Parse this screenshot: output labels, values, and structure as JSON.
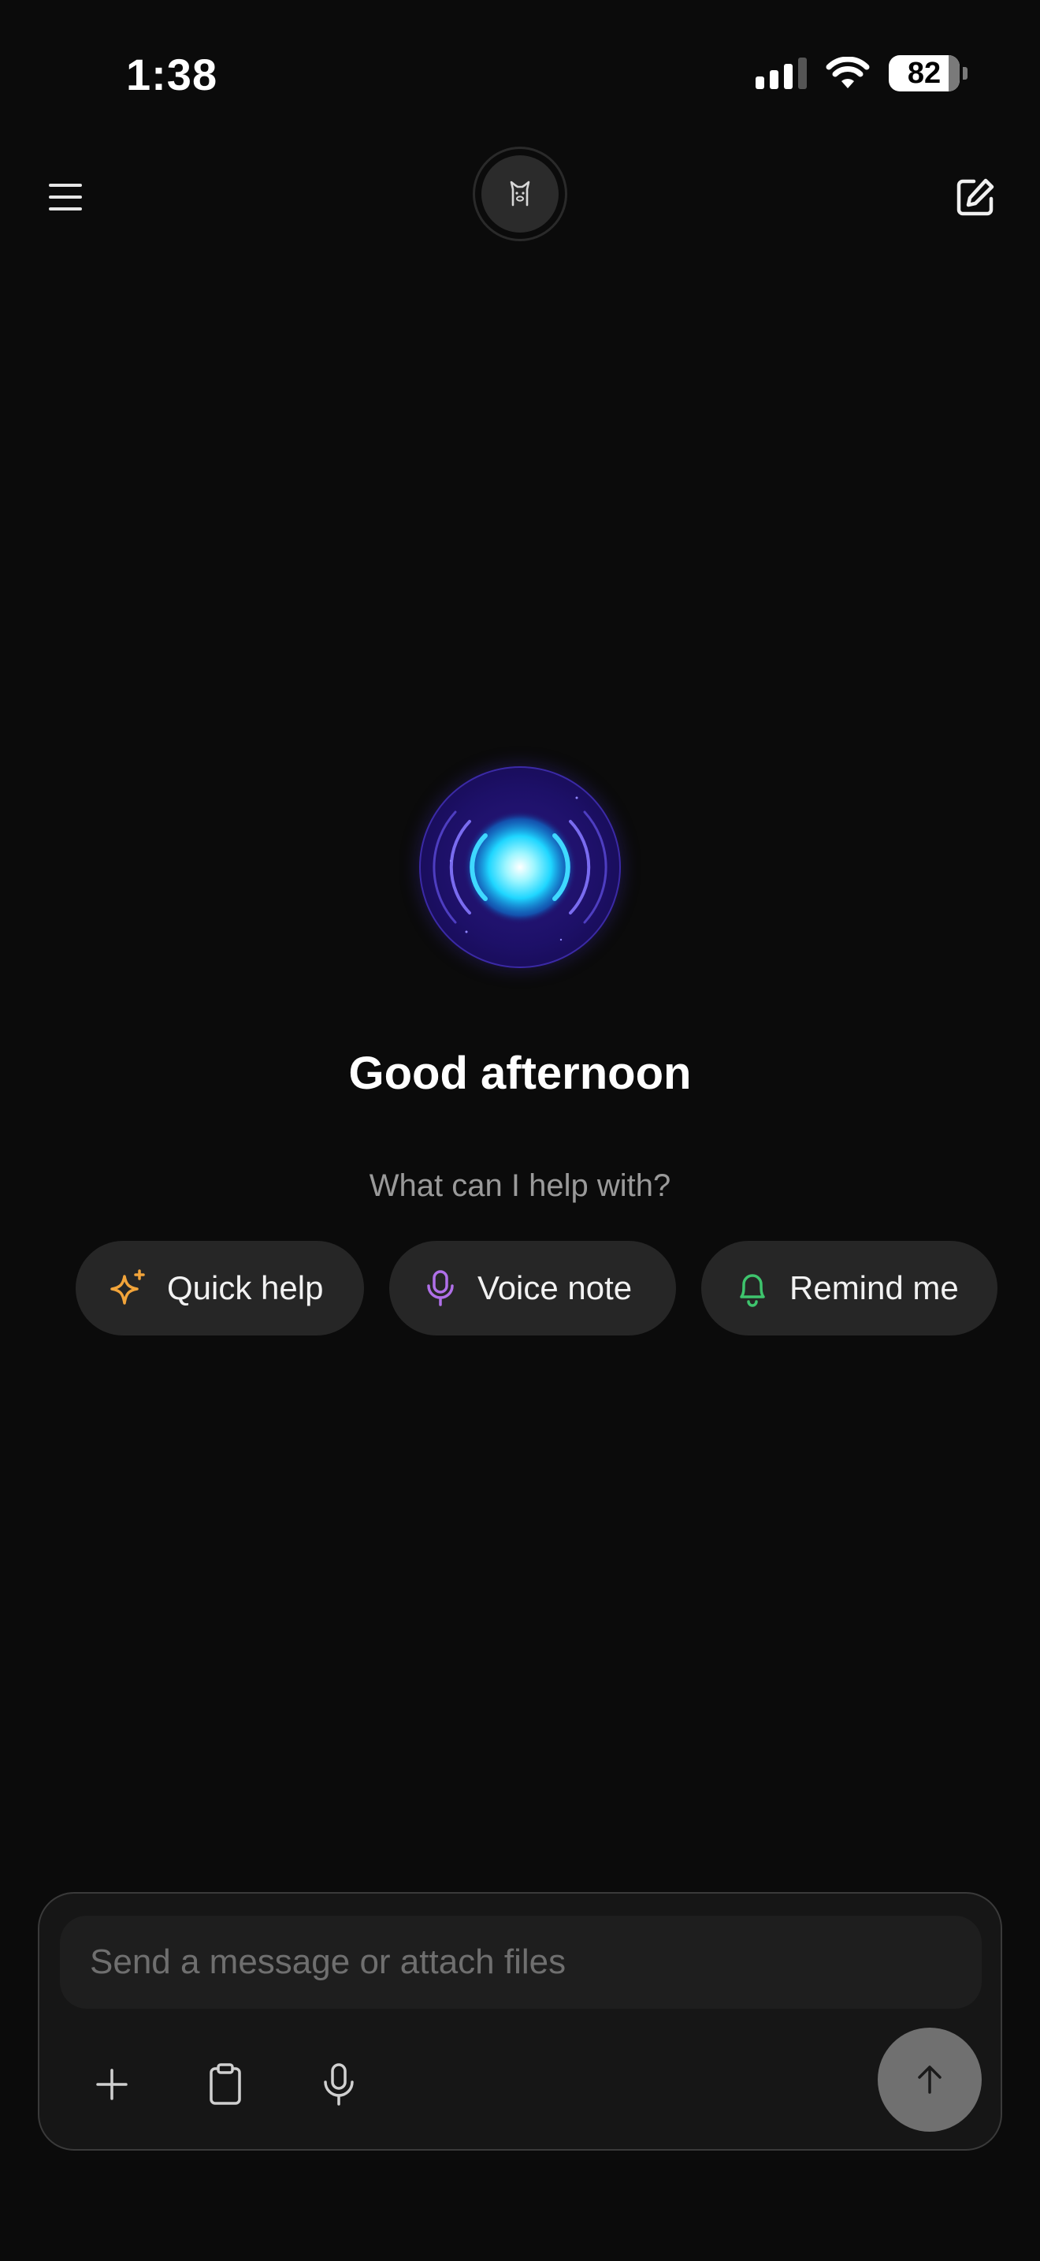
{
  "status_bar": {
    "time": "1:38",
    "battery_percent": "82",
    "signal_bars_active": 3,
    "signal_bars_total": 4
  },
  "nav": {
    "menu_icon": "hamburger-menu-icon",
    "avatar_icon": "llama-avatar-icon",
    "compose_icon": "compose-edit-icon"
  },
  "hero": {
    "greeting": "Good afternoon",
    "subtitle": "What can I help with?"
  },
  "suggestions": [
    {
      "label": "Quick help",
      "icon": "sparkles-icon",
      "color": "#f2a43a"
    },
    {
      "label": "Voice note",
      "icon": "microphone-icon",
      "color": "#b070e8"
    },
    {
      "label": "Remind me",
      "icon": "bell-icon",
      "color": "#3ec46d"
    }
  ],
  "composer": {
    "placeholder": "Send a message or attach files",
    "tools": [
      "plus-icon",
      "clipboard-icon",
      "microphone-icon"
    ],
    "send_icon": "arrow-up-icon"
  },
  "colors": {
    "background": "#0b0b0b",
    "chip_background": "#262626",
    "orb_core": "#3ee8ff",
    "orb_ring": "#1d1068"
  }
}
